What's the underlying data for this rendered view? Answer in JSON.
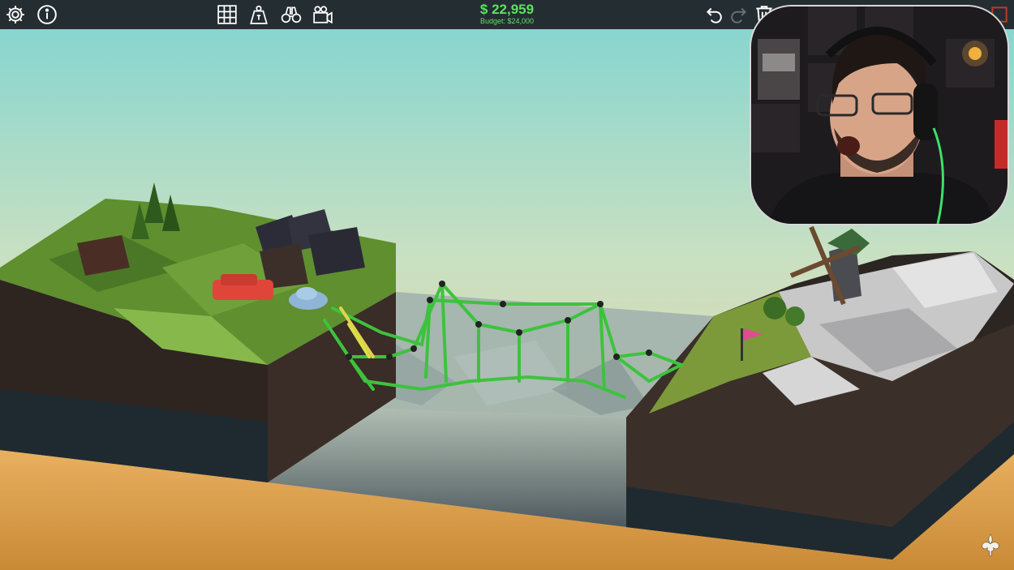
{
  "hud": {
    "money": "$ 22,959",
    "budget": "Budget: $24,000"
  },
  "toolbar": {
    "left": [
      "gear-icon",
      "info-icon"
    ],
    "center": [
      "grid-icon",
      "weight-icon",
      "binoculars-icon",
      "camera-icon"
    ],
    "right": [
      "undo-icon",
      "redo-icon",
      "trash-icon",
      "hand-icon",
      "stop-icon"
    ]
  },
  "colors": {
    "toolbar": "#1c2024",
    "money_green": "#5ce25c",
    "bridge_green": "#3ec23e",
    "sky_top": "#7fd4d1",
    "sky_bottom": "#e8d3a3",
    "desert": "#d99c48"
  }
}
